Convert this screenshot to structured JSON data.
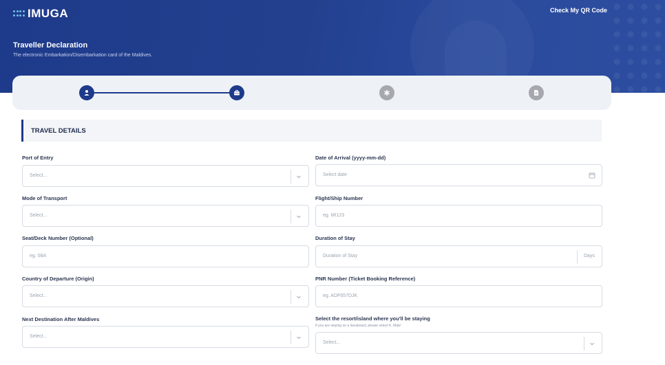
{
  "header": {
    "logo_text": "IMUGA",
    "qr_link": "Check My QR Code",
    "title": "Traveller Declaration",
    "subtitle": "The electronic Embarkation/Disembarkation card of the Maldives."
  },
  "stepper": {
    "steps": [
      {
        "icon": "user-icon",
        "state": "active"
      },
      {
        "icon": "briefcase-icon",
        "state": "active"
      },
      {
        "icon": "asterisk-icon",
        "state": "inactive"
      },
      {
        "icon": "document-icon",
        "state": "inactive"
      }
    ]
  },
  "section": {
    "title": "TRAVEL DETAILS"
  },
  "form": {
    "port_of_entry": {
      "label": "Port of Entry",
      "placeholder": "Select..."
    },
    "date_of_arrival": {
      "label": "Date of Arrival (yyyy-mm-dd)",
      "placeholder": "Select date"
    },
    "mode_of_transport": {
      "label": "Mode of Transport",
      "placeholder": "Select..."
    },
    "flight_number": {
      "label": "Flight/Ship Number",
      "placeholder": "eg. MI123"
    },
    "seat_number": {
      "label": "Seat/Deck Number (Optional)",
      "placeholder": "eg. 08A"
    },
    "duration_of_stay": {
      "label": "Duration of Stay",
      "placeholder": "Duration of Stay",
      "suffix": "Days"
    },
    "country_of_departure": {
      "label": "Country of Departure (Origin)",
      "placeholder": "Select..."
    },
    "pnr_number": {
      "label": "PNR Number (Ticket Booking Reference)",
      "placeholder": "eg. ADF657DJK"
    },
    "next_destination": {
      "label": "Next Destination After Maldives",
      "placeholder": "Select..."
    },
    "resort_island": {
      "label": "Select the resort/island where you'll be staying",
      "hint": "If you are staying on a liveaboard, please select K. Male'",
      "placeholder": "Select..."
    }
  },
  "colors": {
    "primary": "#1e3a8a",
    "inactive_step": "#a5a8ae",
    "stepper_bg": "#eef2f6"
  }
}
